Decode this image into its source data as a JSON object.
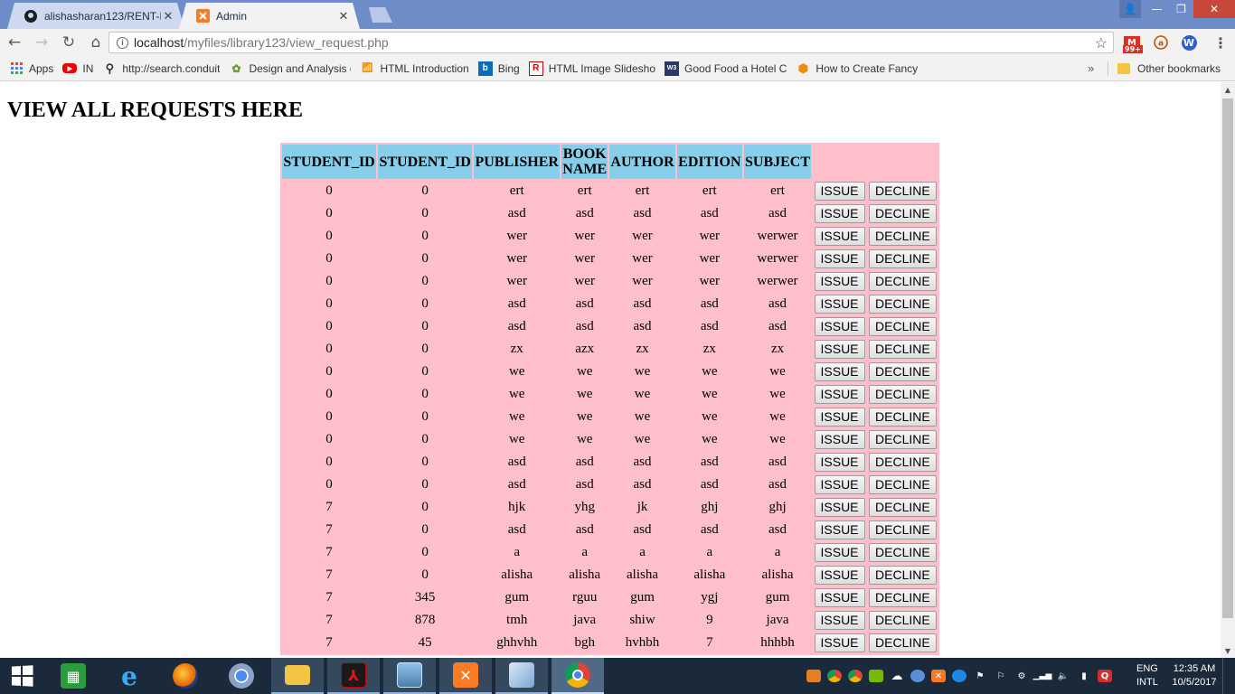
{
  "browser": {
    "tabs": [
      {
        "label": "alishasharan123/RENT-IT",
        "favicon": "github-icon"
      },
      {
        "label": "Admin",
        "favicon": "xampp-icon"
      }
    ],
    "url_host": "localhost",
    "url_path": "/myfiles/library123/view_request.php",
    "extensions": {
      "mail_badge": "99+"
    },
    "bookmarks": [
      {
        "label": "Apps"
      },
      {
        "label": "IN"
      },
      {
        "label": "http://search.conduit"
      },
      {
        "label": "Design and Analysis c"
      },
      {
        "label": "HTML Introduction"
      },
      {
        "label": "Bing"
      },
      {
        "label": "HTML Image Slidesho"
      },
      {
        "label": "Good Food a Hotel C"
      },
      {
        "label": "How to Create Fancy"
      }
    ],
    "more_bookmarks": "»",
    "other_bookmarks": "Other bookmarks"
  },
  "page": {
    "title": "VIEW ALL REQUESTS HERE",
    "headers": [
      "STUDENT_ID",
      "STUDENT_ID",
      "PUBLISHER",
      "BOOK NAME",
      "AUTHOR",
      "EDITION",
      "SUBJECT"
    ],
    "issue_label": "ISSUE",
    "decline_label": "DECLINE",
    "rows": [
      [
        "0",
        "0",
        "ert",
        "ert",
        "ert",
        "ert",
        "ert"
      ],
      [
        "0",
        "0",
        "asd",
        "asd",
        "asd",
        "asd",
        "asd"
      ],
      [
        "0",
        "0",
        "wer",
        "wer",
        "wer",
        "wer",
        "werwer"
      ],
      [
        "0",
        "0",
        "wer",
        "wer",
        "wer",
        "wer",
        "werwer"
      ],
      [
        "0",
        "0",
        "wer",
        "wer",
        "wer",
        "wer",
        "werwer"
      ],
      [
        "0",
        "0",
        "asd",
        "asd",
        "asd",
        "asd",
        "asd"
      ],
      [
        "0",
        "0",
        "asd",
        "asd",
        "asd",
        "asd",
        "asd"
      ],
      [
        "0",
        "0",
        "zx",
        "azx",
        "zx",
        "zx",
        "zx"
      ],
      [
        "0",
        "0",
        "we",
        "we",
        "we",
        "we",
        "we"
      ],
      [
        "0",
        "0",
        "we",
        "we",
        "we",
        "we",
        "we"
      ],
      [
        "0",
        "0",
        "we",
        "we",
        "we",
        "we",
        "we"
      ],
      [
        "0",
        "0",
        "we",
        "we",
        "we",
        "we",
        "we"
      ],
      [
        "0",
        "0",
        "asd",
        "asd",
        "asd",
        "asd",
        "asd"
      ],
      [
        "0",
        "0",
        "asd",
        "asd",
        "asd",
        "asd",
        "asd"
      ],
      [
        "7",
        "0",
        "hjk",
        "yhg",
        "jk",
        "ghj",
        "ghj"
      ],
      [
        "7",
        "0",
        "asd",
        "asd",
        "asd",
        "asd",
        "asd"
      ],
      [
        "7",
        "0",
        "a",
        "a",
        "a",
        "a",
        "a"
      ],
      [
        "7",
        "0",
        "alisha",
        "alisha",
        "alisha",
        "alisha",
        "alisha"
      ],
      [
        "7",
        "345",
        "gum",
        "rguu",
        "gum",
        "ygj",
        "gum"
      ],
      [
        "7",
        "878",
        "tmh",
        "java",
        "shiw",
        "9",
        "java"
      ],
      [
        "7",
        "45",
        "ghhvhh",
        "bgh",
        "hvhbh",
        "7",
        "hhhbh"
      ]
    ],
    "colors": {
      "table_bg": "#ffc0cb",
      "header_bg": "#87ceeb"
    }
  },
  "taskbar": {
    "language": "ENG",
    "layout": "INTL",
    "time": "12:35 AM",
    "date": "10/5/2017"
  }
}
